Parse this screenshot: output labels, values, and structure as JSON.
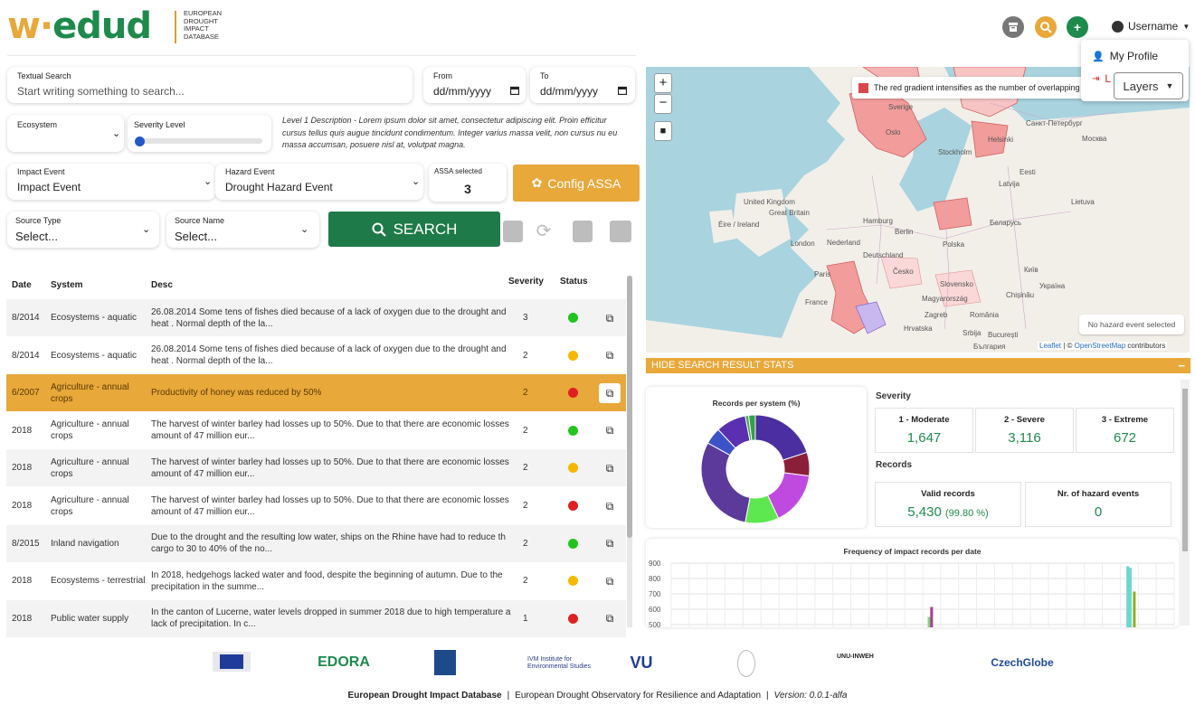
{
  "header": {
    "logo_text_w": "w·",
    "logo_text_edud": "edud",
    "logo_subtitle": [
      "EUROPEAN",
      "DROUGHT",
      "IMPACT",
      "DATABASE"
    ],
    "username": "Username",
    "profile_menu": {
      "my_profile": "My Profile",
      "logout_partial": "L"
    }
  },
  "filters": {
    "textual_search": {
      "label": "Textual Search",
      "placeholder": "Start writing something to search..."
    },
    "from": {
      "label": "From",
      "value": "dd/mm/yyyy"
    },
    "to": {
      "label": "To",
      "value": "dd/mm/yyyy"
    },
    "ecosystem": {
      "label": "Ecosystem",
      "value": ""
    },
    "severity": {
      "label": "Severity Level",
      "level": 0
    },
    "level_description": "Level 1 Description - Lorem ipsum dolor sit amet, consectetur adipiscing elit. Proin efficitur cursus tellus quis augue tincidunt condimentum. Integer varius massa velit, non cursus nu eu massa accumsan, posuere nisl at, volutpat magna.",
    "impact_event": {
      "label": "Impact Event",
      "value": "Impact Event"
    },
    "hazard_event": {
      "label": "Hazard Event",
      "value": "Drought Hazard Event"
    },
    "assa": {
      "label": "ASSA selected",
      "value": "3"
    },
    "config_assa_label": "Config ASSA",
    "source_type": {
      "label": "Source Type",
      "value": "Select..."
    },
    "source_name": {
      "label": "Source Name",
      "value": "Select..."
    },
    "search_label": "SEARCH"
  },
  "table": {
    "headers": {
      "date": "Date",
      "system": "System",
      "desc": "Desc",
      "severity": "Severity",
      "status": "Status"
    },
    "rows": [
      {
        "date": "8/2014",
        "system": "Ecosystems - aquatic",
        "desc": "26.08.2014 Some tens of fishes died because of a lack of oxygen due to the drought and heat . Normal depth of the la...",
        "severity": "3",
        "status": "#22c41e",
        "highlight": false
      },
      {
        "date": "8/2014",
        "system": "Ecosystems - aquatic",
        "desc": "26.08.2014 Some tens of fishes died because of a lack of oxygen due to the drought and heat . Normal depth of the la...",
        "severity": "2",
        "status": "#f5b800",
        "highlight": false
      },
      {
        "date": "6/2007",
        "system": "Agriculture - annual crops",
        "desc": "Productivity of honey was reduced by 50%",
        "severity": "2",
        "status": "#e02020",
        "highlight": true
      },
      {
        "date": "2018",
        "system": "Agriculture - annual crops",
        "desc": "The harvest of winter barley had losses up to 50%. Due to that there are economic losses amount of 47 million eur...",
        "severity": "2",
        "status": "#22c41e",
        "highlight": false
      },
      {
        "date": "2018",
        "system": "Agriculture - annual crops",
        "desc": "The harvest of winter barley had losses up to 50%. Due to that there are economic losses amount of 47 million eur...",
        "severity": "2",
        "status": "#f5b800",
        "highlight": false
      },
      {
        "date": "2018",
        "system": "Agriculture - annual crops",
        "desc": "The harvest of winter barley had losses up to 50%. Due to that there are economic losses amount of 47 million eur...",
        "severity": "2",
        "status": "#e02020",
        "highlight": false
      },
      {
        "date": "8/2015",
        "system": "Inland navigation",
        "desc": "Due to the drought and the resulting low water, ships on the Rhine have had to reduce th cargo to 30 to 40% of the no...",
        "severity": "2",
        "status": "#22c41e",
        "highlight": false
      },
      {
        "date": "2018",
        "system": "Ecosystems - terrestrial",
        "desc": "In 2018, hedgehogs lacked water and food, despite the beginning of autumn. Due to the precipitation in the summe...",
        "severity": "2",
        "status": "#f5b800",
        "highlight": false
      },
      {
        "date": "2018",
        "system": "Public water supply",
        "desc": "In the canton of Lucerne, water levels dropped in summer 2018 due to high temperature a lack of precipitation. In c...",
        "severity": "1",
        "status": "#e02020",
        "highlight": false
      }
    ]
  },
  "map": {
    "legend_text": "The red gradient intensifies as the number of overlapping",
    "no_hazard": "No hazard event selected",
    "attribution_leaflet": "Leaflet",
    "attribution_osm": "OpenStreetMap",
    "attribution_contrib": "contributors",
    "layers_label": "Layers",
    "places": [
      "Oslo",
      "Stockholm",
      "Helsinki",
      "Санкт-Петербург",
      "Eesti",
      "Latvija",
      "Lietuva",
      "Москва",
      "United Kingdom",
      "Great Britain",
      "Éire / Ireland",
      "London",
      "Nederland",
      "Hamburg",
      "Berlin",
      "Беларусь",
      "Polska",
      "Deutschland",
      "Paris",
      "France",
      "Česko",
      "Slovensko",
      "Україна",
      "Magyarország",
      "Chișinău",
      "Київ",
      "Zagreb",
      "Hrvatska",
      "România",
      "Srbija",
      "București",
      "България",
      "Sverige"
    ]
  },
  "stats": {
    "hide_label": "HIDE SEARCH RESULT STATS",
    "pie_title": "Records per system (%)",
    "severity_title": "Severity",
    "severity_boxes": [
      {
        "label": "1 - Moderate",
        "value": "1,647"
      },
      {
        "label": "2 - Severe",
        "value": "3,116"
      },
      {
        "label": "3 - Extreme",
        "value": "672"
      }
    ],
    "records_title": "Records",
    "valid_label": "Valid records",
    "valid_value": "5,430",
    "valid_pct": "(99.80 %)",
    "hazard_label": "Nr. of hazard events",
    "hazard_value": "0",
    "freq_title": "Frequency of impact records per date"
  },
  "chart_data": [
    {
      "type": "pie",
      "title": "Records per system (%)",
      "slices": [
        {
          "value": 20,
          "color": "#4b2fa0"
        },
        {
          "value": 7,
          "color": "#8a1f3a"
        },
        {
          "value": 16,
          "color": "#c04ae0"
        },
        {
          "value": 10,
          "color": "#5ee850"
        },
        {
          "value": 30,
          "color": "#5b3a9c"
        },
        {
          "value": 5,
          "color": "#3e52c8"
        },
        {
          "value": 9,
          "color": "#5a2fb0"
        },
        {
          "value": 1,
          "color": "#4aa05a"
        },
        {
          "value": 2,
          "color": "#36a048"
        }
      ]
    },
    {
      "type": "bar",
      "title": "Frequency of impact records per date",
      "yticks": [
        900,
        800,
        700,
        600,
        500
      ],
      "ylim": [
        480,
        900
      ],
      "bars": [
        {
          "x": 0.51,
          "value": 550,
          "color": "#7ad67a"
        },
        {
          "x": 0.515,
          "value": 615,
          "color": "#b0388f"
        },
        {
          "x": 0.905,
          "value": 880,
          "color": "#6ed6d0"
        },
        {
          "x": 0.91,
          "value": 870,
          "color": "#6ed6d0"
        },
        {
          "x": 0.918,
          "value": 715,
          "color": "#8fb020"
        }
      ]
    }
  ],
  "footer": {
    "logos": [
      "EDORA",
      "VU",
      "CzechGlobe",
      "IVM Institute for Environmental Studies",
      "UNU-INWEH"
    ],
    "title_bold": "European Drought Impact Database",
    "sep": "|",
    "observatory": "European Drought Observatory for Resilience and Adaptation",
    "version_label": "Version:",
    "version_value": "0.0.1-alfa"
  }
}
